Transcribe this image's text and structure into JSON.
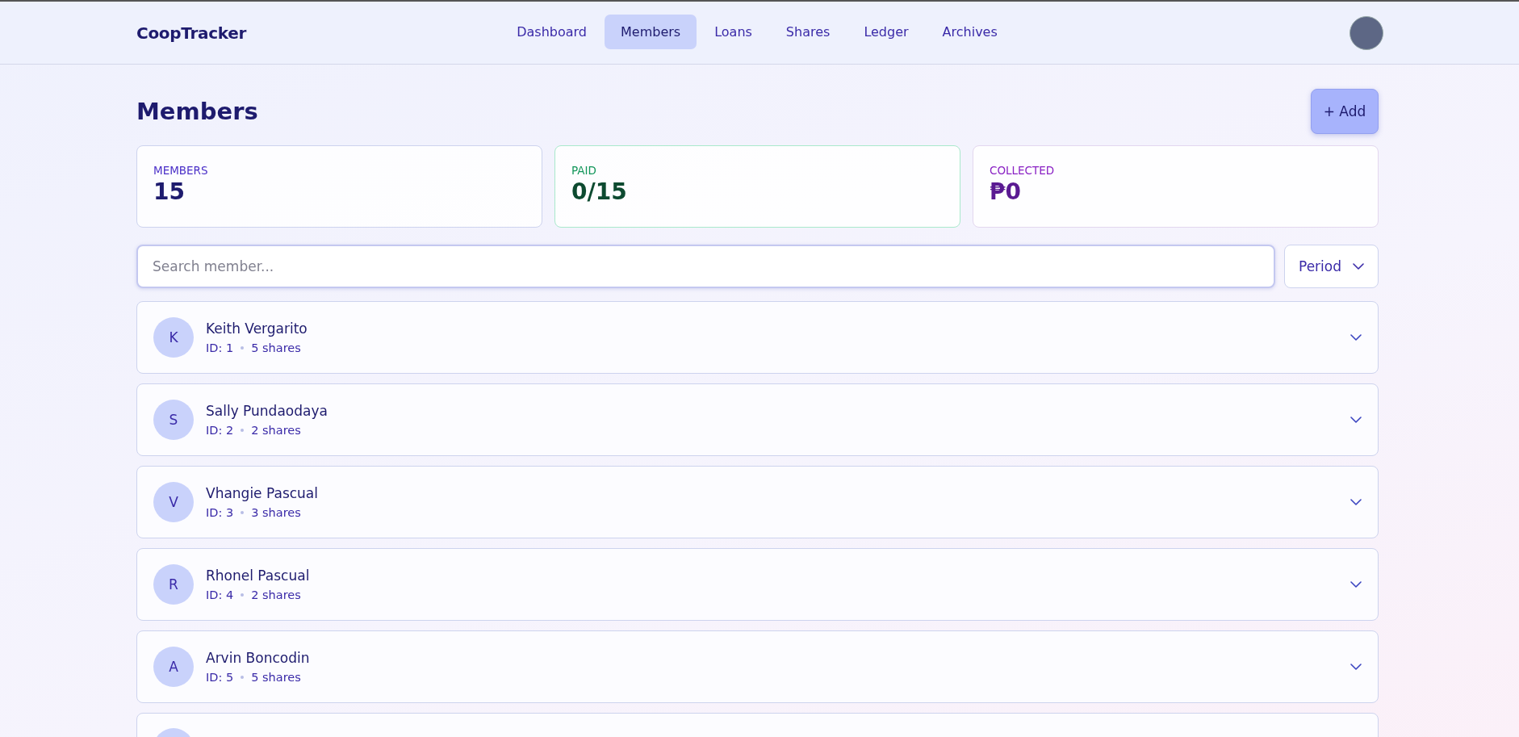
{
  "header": {
    "brand": "CoopTracker",
    "nav": [
      {
        "label": "Dashboard",
        "selected": false
      },
      {
        "label": "Members",
        "selected": true
      },
      {
        "label": "Loans",
        "selected": false
      },
      {
        "label": "Shares",
        "selected": false
      },
      {
        "label": "Ledger",
        "selected": false
      },
      {
        "label": "Archives",
        "selected": false
      }
    ]
  },
  "page": {
    "title": "Members",
    "add_button": "+ Add"
  },
  "stats": [
    {
      "kind": "members",
      "label": "MEMBERS",
      "value": "15"
    },
    {
      "kind": "paid",
      "label": "PAID",
      "value": "0/15"
    },
    {
      "kind": "collected",
      "label": "COLLECTED",
      "value": "₱0"
    }
  ],
  "search": {
    "placeholder": "Search member..."
  },
  "period": {
    "label": "Period"
  },
  "members": [
    {
      "initial": "K",
      "name": "Keith Vergarito",
      "id": "ID: 1",
      "shares": "5 shares",
      "expanded": false
    },
    {
      "initial": "S",
      "name": "Sally Pundaodaya",
      "id": "ID: 2",
      "shares": "2 shares",
      "expanded": false
    },
    {
      "initial": "V",
      "name": "Vhangie Pascual",
      "id": "ID: 3",
      "shares": "3 shares",
      "expanded": false
    },
    {
      "initial": "R",
      "name": "Rhonel Pascual",
      "id": "ID: 4",
      "shares": "2 shares",
      "expanded": false
    },
    {
      "initial": "A",
      "name": "Arvin Boncodin",
      "id": "ID: 5",
      "shares": "5 shares",
      "expanded": false
    },
    {
      "kind": "partial"
    }
  ]
}
